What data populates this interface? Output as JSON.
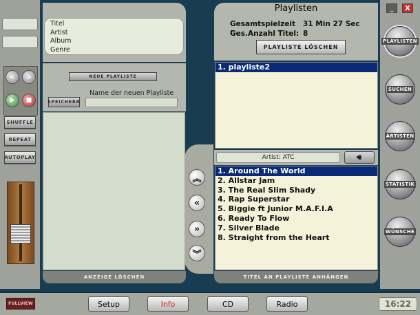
{
  "metadata": {
    "fields": [
      "Titel",
      "Artist",
      "Album",
      "Genre"
    ]
  },
  "new_playlist": {
    "new_button": "NEUE PLAYLISTE",
    "save_button": "SPEICHERN",
    "name_label": "Name der neuen Playliste",
    "name_value": ""
  },
  "left_controls": {
    "prev_label": "<",
    "next_label": ">",
    "play_label": "▶",
    "stop_label": "■",
    "shuffle": "SHUFFLE",
    "repeat": "REPEAT",
    "autoplay": "AUTOPLAY"
  },
  "left_bottom": "ANZEIGE LÖSCHEN",
  "transfer": {
    "top": "≈",
    "left": "«",
    "right": "»",
    "bottom": "≈"
  },
  "playlists_panel": {
    "title": "Playlisten",
    "total_time_label": "Gesamtspielzeit :",
    "total_time_value": "31 Min 27 Sec",
    "total_count_label": "Ges.Anzahl Titel:",
    "total_count_value": "8",
    "delete_button": "PLAYLISTE LÖSCHEN",
    "items": [
      "1. playliste2"
    ]
  },
  "artist_filter": "Artist: ATC",
  "tracks": [
    "1. Around The World",
    "2. Allstar Jam",
    "3. The Real Slim Shady",
    "4. Rap Superstar",
    "5. Biggie ft Junior M.A.F.I.A",
    "6. Ready To Flow",
    "7. Silver Blade",
    "8. Straight from the Heart"
  ],
  "right_bottom": "TITEL AN PLAYLISTE ANHÄNGEN",
  "window_buttons": {
    "minimize": "_",
    "close": "X"
  },
  "nav": [
    "PLAYLISTEN",
    "SUCHEN",
    "ARTISTEN",
    "STATISTIK",
    "WÜNSCHE"
  ],
  "bottom": {
    "fullview": "FULLVIEW",
    "setup": "Setup",
    "info": "Info",
    "cd": "CD",
    "radio": "Radio",
    "clock": "16:22"
  },
  "colors": {
    "background": "#183c52",
    "selection": "#0a2a78",
    "list_bg": "#f4f2d9",
    "close_red": "#c43030",
    "info_text": "#d02020"
  }
}
